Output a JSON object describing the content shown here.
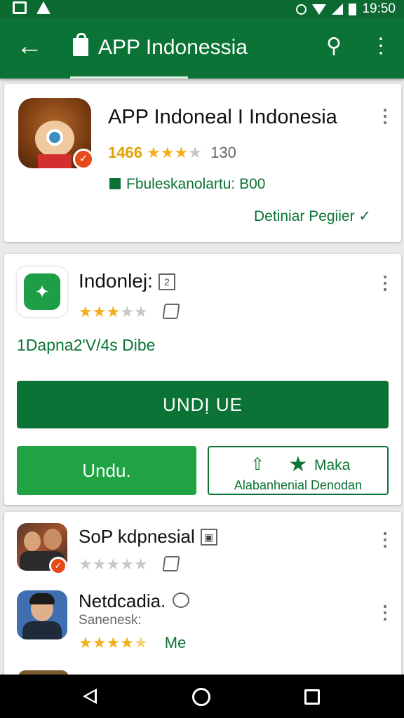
{
  "status_bar": {
    "time": "19:50"
  },
  "app_bar": {
    "title": "APP Indonessia",
    "back_icon": "arrow-back-icon",
    "share_icon": "share-icon",
    "more_icon": "more-vert-icon"
  },
  "card1": {
    "title": "APP Indoneal I Indonesia",
    "rating": "1466",
    "stars": 3.5,
    "count": "130",
    "downloads": "Fbuleskanolartu: B00",
    "details_link": "Detiniar Pegiier",
    "details_chevron": "✓"
  },
  "card2": {
    "title": "Indonlej:",
    "title_badge": "2",
    "stars": 3,
    "meta": "1Dapna2'V/4s Dibe",
    "primary_button": "UNDỊ UE",
    "green_button": "Undu.",
    "outline_button_top": "Maka",
    "outline_button_bottom": "Alabanhenial Denodan"
  },
  "list": {
    "items": [
      {
        "title": "SoP kdpnesial",
        "stars": 0
      },
      {
        "title": "Netdcadia.",
        "subtitle": "Sanenesk:",
        "stars": 4.5,
        "suffix": "Me"
      }
    ]
  },
  "colors": {
    "primary": "#0b7335",
    "accent_green": "#1fa343",
    "star": "#f2b01e"
  }
}
